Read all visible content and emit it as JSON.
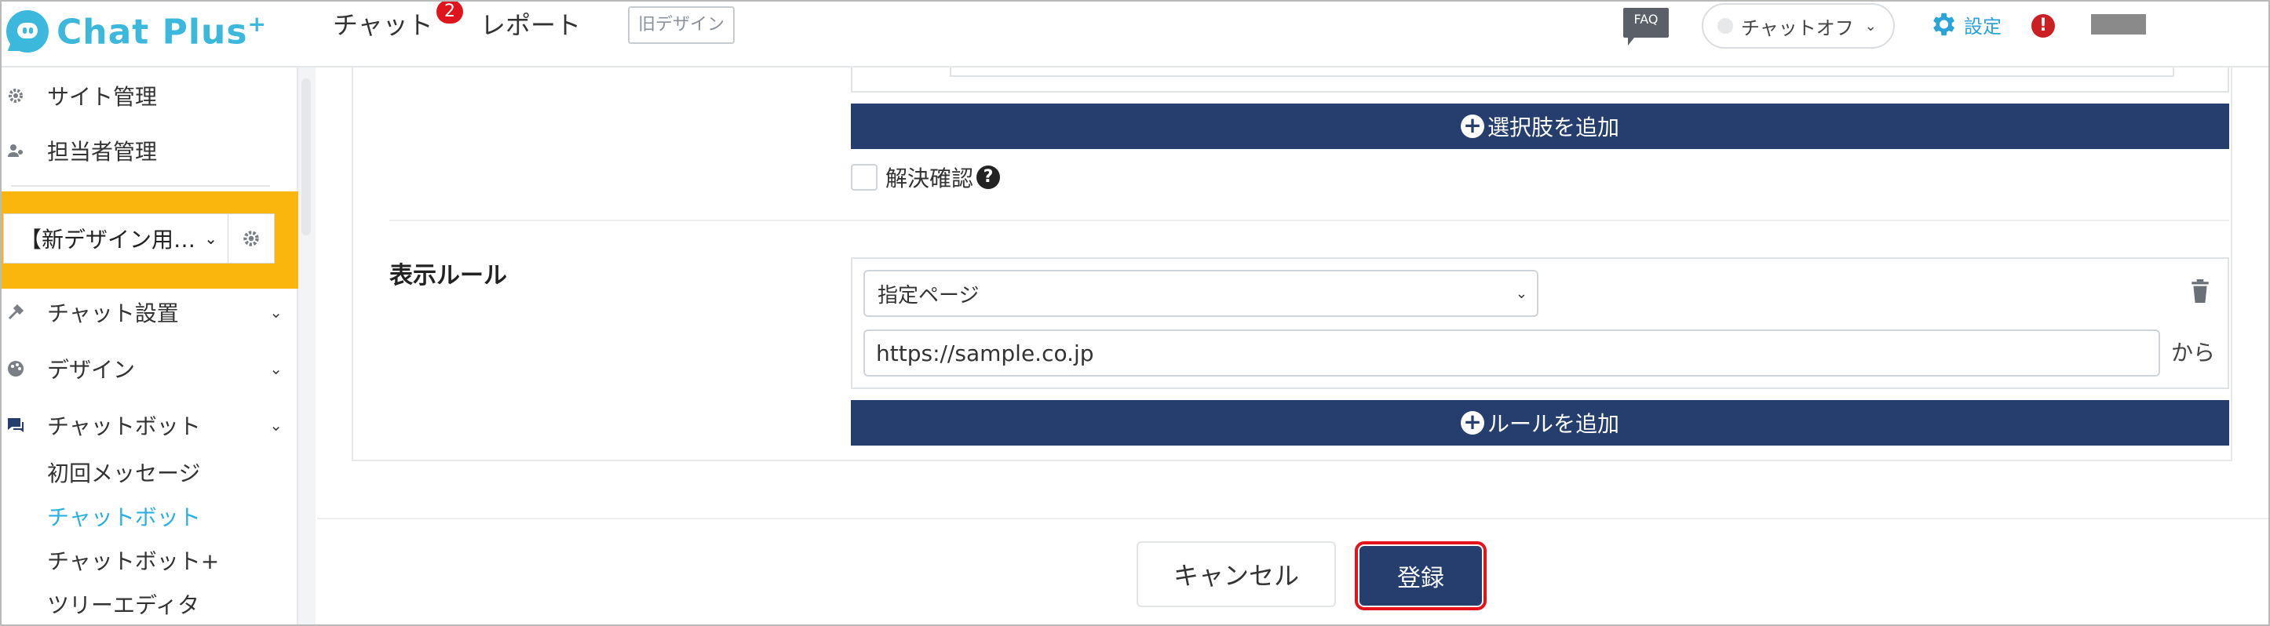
{
  "header": {
    "logo_text": "Chat Plus",
    "logo_plus": "+",
    "nav": [
      {
        "label": "チャット",
        "badge": "2"
      },
      {
        "label": "レポート"
      }
    ],
    "old_design_label": "旧デザイン",
    "faq_label": "FAQ",
    "chat_status_label": "チャットオフ",
    "settings_label": "設定",
    "alert_label": "!"
  },
  "sidebar": {
    "items_top": [
      {
        "label": "サイト管理",
        "icon": "gear-cog-icon"
      },
      {
        "label": "担当者管理",
        "icon": "users-icon"
      }
    ],
    "site_select_value": "【新デザイン用…",
    "sections": [
      {
        "label": "チャット設置",
        "icon": "tools-icon"
      },
      {
        "label": "デザイン",
        "icon": "palette-icon"
      },
      {
        "label": "チャットボット",
        "icon": "chat-bubble-icon"
      }
    ],
    "subitems": [
      {
        "label": "初回メッセージ",
        "active": false
      },
      {
        "label": "チャットボット",
        "active": true
      },
      {
        "label": "チャットボット+",
        "active": false
      },
      {
        "label": "ツリーエディタ",
        "active": false
      }
    ]
  },
  "main": {
    "add_option_label": "選択肢を追加",
    "resolve_confirm_label": "解決確認",
    "help_icon_text": "?",
    "display_rule_label": "表示ルール",
    "rule_type_value": "指定ページ",
    "rule_url_value": "https://sample.co.jp",
    "rule_url_suffix": "から",
    "add_rule_label": "ルールを追加",
    "cancel_label": "キャンセル",
    "submit_label": "登録"
  },
  "colors": {
    "brand": "#3db8dd",
    "primary_button": "#253e6d",
    "site_selector_bg": "#fbb60d",
    "highlight_border": "#e3121b",
    "badge": "#e0141d",
    "active_link": "#2ab0e0"
  }
}
